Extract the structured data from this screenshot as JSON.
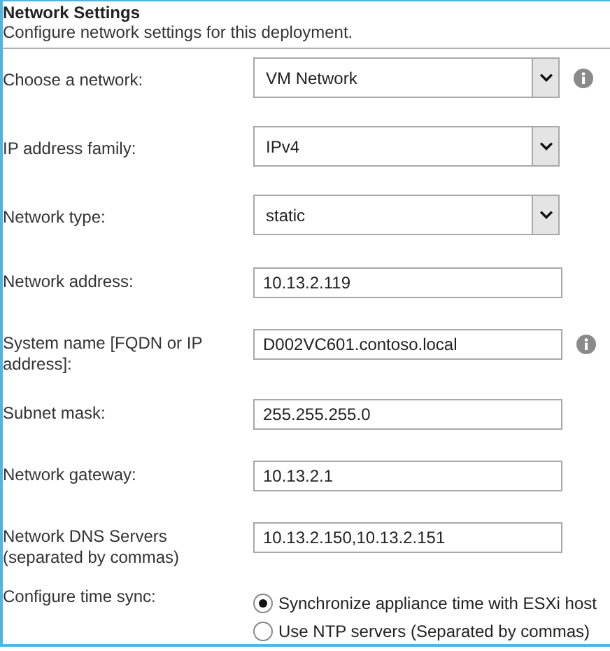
{
  "section": {
    "title": "Network Settings",
    "description": "Configure network settings for this deployment."
  },
  "fields": [
    {
      "kind": "select",
      "label": "Choose a network:",
      "value": "VM Network",
      "info": true
    },
    {
      "kind": "select",
      "label": "IP address family:",
      "value": "IPv4",
      "info": false
    },
    {
      "kind": "select",
      "label": "Network type:",
      "value": "static",
      "info": false
    },
    {
      "kind": "text",
      "label": "Network address:",
      "value": "10.13.2.119",
      "info": false
    },
    {
      "kind": "text",
      "label": "System name [FQDN or IP address]:",
      "value": "D002VC601.contoso.local",
      "info": true
    },
    {
      "kind": "text",
      "label": "Subnet mask:",
      "value": "255.255.255.0",
      "info": false
    },
    {
      "kind": "text",
      "label": "Network gateway:",
      "value": "10.13.2.1",
      "info": false
    },
    {
      "kind": "text",
      "label": "Network DNS Servers (separated by commas)",
      "value": "10.13.2.150,10.13.2.151",
      "info": false
    },
    {
      "kind": "radio",
      "label": "Configure time sync:",
      "options": [
        {
          "label": "Synchronize appliance time with ESXi host",
          "selected": true
        },
        {
          "label": "Use NTP servers (Separated by commas)",
          "selected": false
        }
      ]
    }
  ]
}
